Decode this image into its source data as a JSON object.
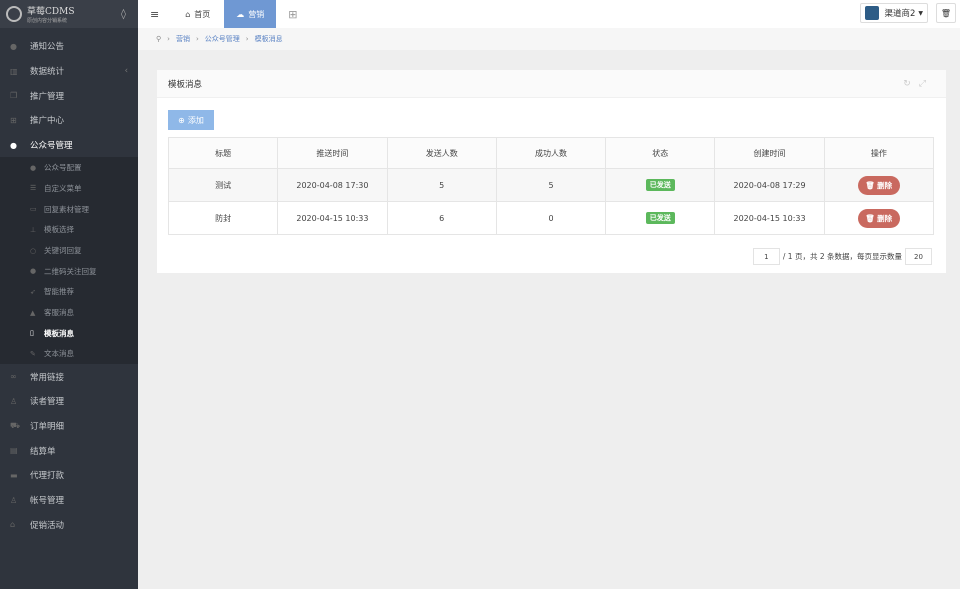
{
  "brand": {
    "name": "草莓CDMS",
    "subtitle": "原创内容分销系统"
  },
  "sidebar": {
    "items": [
      {
        "label": "通知公告",
        "icon": "comment-icon"
      },
      {
        "label": "数据统计",
        "icon": "bar-chart-icon"
      },
      {
        "label": "推广管理",
        "icon": "copy-icon"
      },
      {
        "label": "推广中心",
        "icon": "sitemap-icon"
      },
      {
        "label": "公众号管理",
        "icon": "wechat-icon"
      },
      {
        "label": "常用链接",
        "icon": "link-icon"
      },
      {
        "label": "读者管理",
        "icon": "user-icon"
      },
      {
        "label": "订单明细",
        "icon": "cart-icon"
      },
      {
        "label": "结算单",
        "icon": "calculator-icon"
      },
      {
        "label": "代理打款",
        "icon": "keyboard-icon"
      },
      {
        "label": "帐号管理",
        "icon": "user-gear-icon"
      },
      {
        "label": "促销活动",
        "icon": "bank-icon"
      }
    ],
    "sub": [
      "公众号配置",
      "自定义菜单",
      "回复素材管理",
      "模板选择",
      "关键词回复",
      "二维码关注回复",
      "智能推荐",
      "客服消息",
      "模板消息",
      "文本消息"
    ]
  },
  "topbar": {
    "home": "首页",
    "marketing": "营销",
    "channel": "渠道商2"
  },
  "breadcrumb": [
    "营销",
    "公众号管理",
    "模板消息"
  ],
  "panel": {
    "title": "模板消息",
    "add": "添加"
  },
  "table": {
    "headers": [
      "标题",
      "推送时间",
      "发送人数",
      "成功人数",
      "状态",
      "创建时间",
      "操作"
    ],
    "rows": [
      [
        "测试",
        "2020-04-08 17:30",
        "5",
        "5",
        "已发送",
        "2020-04-08 17:29",
        "删除"
      ],
      [
        "防封",
        "2020-04-15 10:33",
        "6",
        "0",
        "已发送",
        "2020-04-15 10:33",
        "删除"
      ]
    ]
  },
  "pager": {
    "page": "1",
    "text": "/ 1 页，共 2 条数据，每页显示数量",
    "size": "20"
  },
  "colors": {
    "accent": "#6f98d3",
    "success": "#5cb85c",
    "danger": "#c9695f"
  }
}
